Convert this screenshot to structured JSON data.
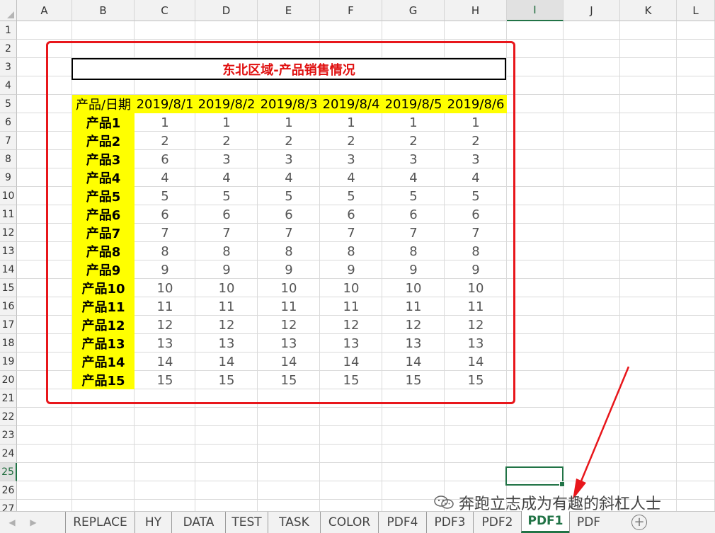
{
  "columns": [
    "A",
    "B",
    "C",
    "D",
    "E",
    "F",
    "G",
    "H",
    "I",
    "J",
    "K",
    "L"
  ],
  "active_column": "I",
  "rows": [
    "1",
    "2",
    "3",
    "4",
    "5",
    "6",
    "7",
    "8",
    "9",
    "10",
    "11",
    "12",
    "13",
    "14",
    "15",
    "16",
    "17",
    "18",
    "19",
    "20",
    "21",
    "22",
    "23",
    "24",
    "25",
    "26",
    "27"
  ],
  "active_row": "25",
  "table": {
    "title": "东北区域-产品销售情况",
    "corner_label": "产品/日期",
    "dates": [
      "2019/8/1",
      "2019/8/2",
      "2019/8/3",
      "2019/8/4",
      "2019/8/5",
      "2019/8/6"
    ],
    "products": [
      {
        "name": "产品1",
        "values": [
          "1",
          "1",
          "1",
          "1",
          "1",
          "1"
        ]
      },
      {
        "name": "产品2",
        "values": [
          "2",
          "2",
          "2",
          "2",
          "2",
          "2"
        ]
      },
      {
        "name": "产品3",
        "values": [
          "6",
          "3",
          "3",
          "3",
          "3",
          "3"
        ]
      },
      {
        "name": "产品4",
        "values": [
          "4",
          "4",
          "4",
          "4",
          "4",
          "4"
        ]
      },
      {
        "name": "产品5",
        "values": [
          "5",
          "5",
          "5",
          "5",
          "5",
          "5"
        ]
      },
      {
        "name": "产品6",
        "values": [
          "6",
          "6",
          "6",
          "6",
          "6",
          "6"
        ]
      },
      {
        "name": "产品7",
        "values": [
          "7",
          "7",
          "7",
          "7",
          "7",
          "7"
        ]
      },
      {
        "name": "产品8",
        "values": [
          "8",
          "8",
          "8",
          "8",
          "8",
          "8"
        ]
      },
      {
        "name": "产品9",
        "values": [
          "9",
          "9",
          "9",
          "9",
          "9",
          "9"
        ]
      },
      {
        "name": "产品10",
        "values": [
          "10",
          "10",
          "10",
          "10",
          "10",
          "10"
        ]
      },
      {
        "name": "产品11",
        "values": [
          "11",
          "11",
          "11",
          "11",
          "11",
          "11"
        ]
      },
      {
        "name": "产品12",
        "values": [
          "12",
          "12",
          "12",
          "12",
          "12",
          "12"
        ]
      },
      {
        "name": "产品13",
        "values": [
          "13",
          "13",
          "13",
          "13",
          "13",
          "13"
        ]
      },
      {
        "name": "产品14",
        "values": [
          "14",
          "14",
          "14",
          "14",
          "14",
          "14"
        ]
      },
      {
        "name": "产品15",
        "values": [
          "15",
          "15",
          "15",
          "15",
          "15",
          "15"
        ]
      }
    ]
  },
  "watermark": "奔跑立志成为有趣的斜杠人士",
  "sheet_tabs": [
    "REPLACE",
    "HY",
    "DATA",
    "TEST",
    "TASK",
    "COLOR",
    "PDF4",
    "PDF3",
    "PDF2",
    "PDF1",
    "PDF"
  ],
  "active_tab": "PDF1",
  "add_sheet_label": "+",
  "colors": {
    "highlight": "#ffff00",
    "title_red": "#e01010",
    "frame_red": "#e8161b",
    "excel_green": "#217346"
  }
}
